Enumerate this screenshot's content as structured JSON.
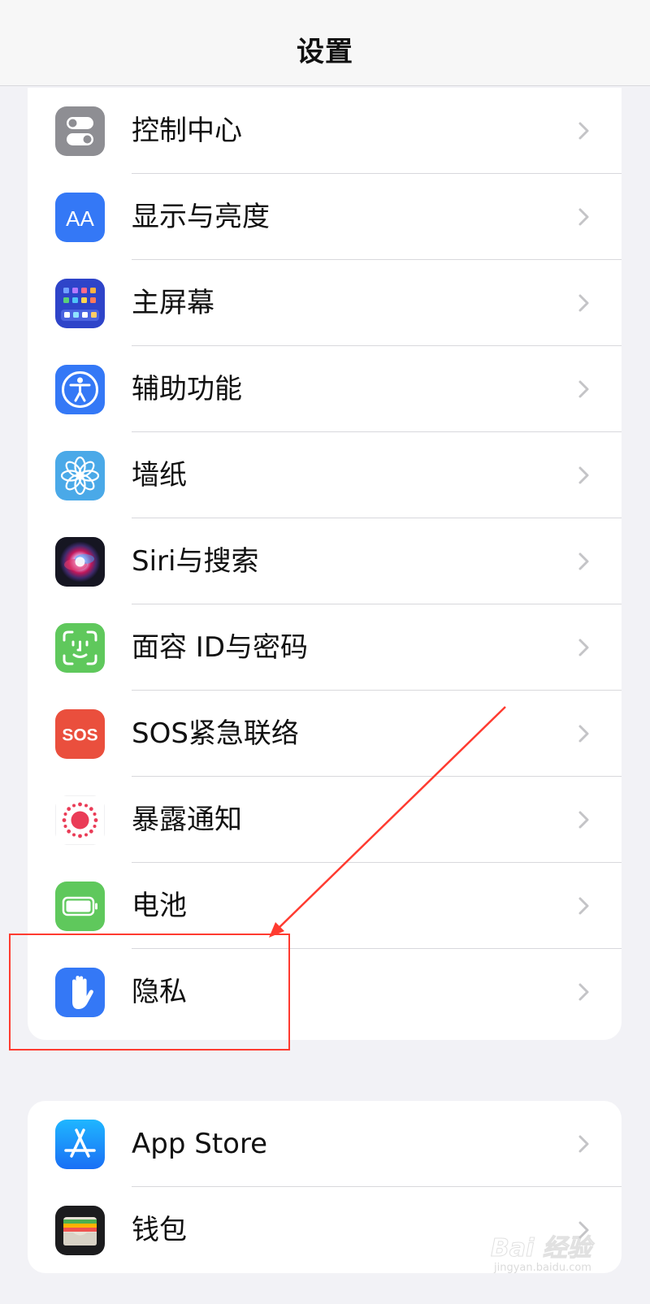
{
  "nav": {
    "title": "设置"
  },
  "group1": {
    "items": [
      {
        "label": "控制中心",
        "icon": "control-center-icon"
      },
      {
        "label": "显示与亮度",
        "icon": "display-brightness-icon"
      },
      {
        "label": "主屏幕",
        "icon": "home-screen-icon"
      },
      {
        "label": "辅助功能",
        "icon": "accessibility-icon"
      },
      {
        "label": "墙纸",
        "icon": "wallpaper-icon"
      },
      {
        "label": "Siri与搜索",
        "icon": "siri-icon"
      },
      {
        "label": "面容 ID与密码",
        "icon": "face-id-icon"
      },
      {
        "label": "SOS紧急联络",
        "icon": "sos-icon"
      },
      {
        "label": "暴露通知",
        "icon": "exposure-notification-icon"
      },
      {
        "label": "电池",
        "icon": "battery-icon"
      },
      {
        "label": "隐私",
        "icon": "privacy-hand-icon"
      }
    ]
  },
  "group2": {
    "items": [
      {
        "label": "App Store",
        "icon": "app-store-icon"
      },
      {
        "label": "钱包",
        "icon": "wallet-icon"
      }
    ]
  },
  "icon_text": {
    "display_aa": "AA",
    "sos": "SOS"
  },
  "watermark": {
    "brand": "Bai 经验",
    "url": "jingyan.baidu.com"
  },
  "colors": {
    "background": "#f2f2f6",
    "annotation": "#ff3b30",
    "gray_icon": "#8e8e93",
    "blue_icon": "#3478f6",
    "green_icon": "#5fc85c",
    "red_icon": "#ea4f3d"
  }
}
